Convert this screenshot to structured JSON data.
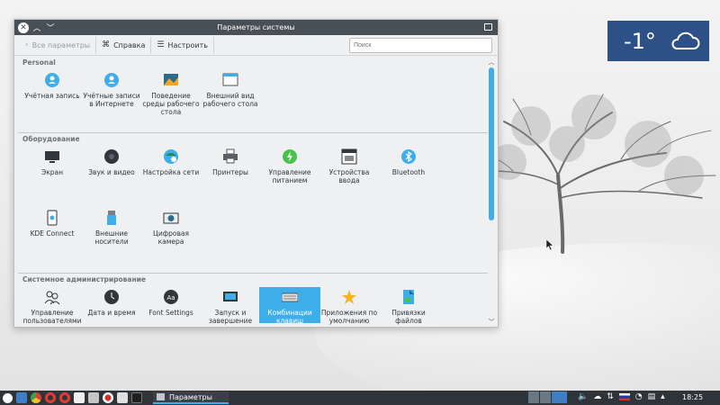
{
  "window": {
    "title": "Параметры системы",
    "toolbar": {
      "back_label": "Все параметры",
      "help_label": "Справка",
      "configure_label": "Настроить",
      "search_placeholder": "Поиск"
    },
    "sections": [
      {
        "title": "Personal",
        "items": [
          {
            "label": "Учётная запись",
            "icon": "user-icon"
          },
          {
            "label": "Учётные записи в Интернете",
            "icon": "online-accounts-icon"
          },
          {
            "label": "Поведение среды рабочего стола",
            "icon": "workspace-behavior-icon"
          },
          {
            "label": "Внешний вид рабочего стола",
            "icon": "workspace-appearance-icon"
          }
        ]
      },
      {
        "title": "Оборудование",
        "items": [
          {
            "label": "Экран",
            "icon": "display-icon"
          },
          {
            "label": "Звук и видео",
            "icon": "multimedia-icon"
          },
          {
            "label": "Настройка сети",
            "icon": "network-icon"
          },
          {
            "label": "Принтеры",
            "icon": "printer-icon"
          },
          {
            "label": "Управление питанием",
            "icon": "power-icon"
          },
          {
            "label": "Устройства ввода",
            "icon": "input-devices-icon"
          },
          {
            "label": "Bluetooth",
            "icon": "bluetooth-icon"
          },
          {
            "label": "KDE Connect",
            "icon": "kde-connect-icon"
          },
          {
            "label": "Внешние носители",
            "icon": "removable-storage-icon"
          },
          {
            "label": "Цифровая камера",
            "icon": "camera-icon"
          }
        ]
      },
      {
        "title": "Системное администрирование",
        "items": [
          {
            "label": "Управление пользователями",
            "icon": "users-icon"
          },
          {
            "label": "Дата и время",
            "icon": "clock-icon"
          },
          {
            "label": "Font Settings",
            "icon": "fonts-icon"
          },
          {
            "label": "Запуск и завершение",
            "icon": "startup-shutdown-icon"
          },
          {
            "label": "Комбинации клавиш",
            "icon": "keyboard-shortcuts-icon"
          },
          {
            "label": "Приложения по умолчанию",
            "icon": "default-apps-icon"
          },
          {
            "label": "Привязки файлов",
            "icon": "file-associations-icon"
          }
        ]
      }
    ]
  },
  "weather": {
    "temperature": "-1°",
    "icon": "cloud-icon"
  },
  "taskbar": {
    "task_label": "Параметры",
    "clock": "18:25"
  },
  "colors": {
    "accent": "#3daee9",
    "titlebar": "#475057",
    "weather_bg": "#2d5086",
    "taskbar_bg": "#2f3439"
  }
}
